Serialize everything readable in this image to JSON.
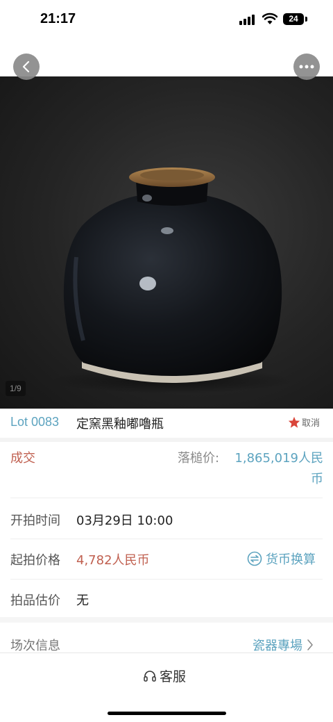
{
  "status_bar": {
    "time": "21:17",
    "battery": "24"
  },
  "header": {
    "back_icon": "chevron-left-icon",
    "more_icon": "more-horizontal-icon"
  },
  "photo": {
    "counter": "1/9"
  },
  "lot": {
    "number": "Lot 0083",
    "title": "定窯黑釉嘟嚕瓶",
    "favorite_label": "取消",
    "favorite_icon": "star-icon",
    "favorite_color": "#d9453a"
  },
  "result": {
    "status": "成交",
    "hammer_label": "落槌价:",
    "hammer_value": "1,865,019人民币"
  },
  "details": {
    "start_time_label": "开拍时间",
    "start_time_value": "03月29日 10:00",
    "start_price_label": "起拍价格",
    "start_price_value": "4,782人民币",
    "currency_convert_label": "货币换算",
    "estimate_label": "拍品估价",
    "estimate_value": "无"
  },
  "session": {
    "label": "场次信息",
    "value": "瓷器專場"
  },
  "bottom": {
    "service_label": "客服",
    "service_icon": "headset-icon"
  },
  "colors": {
    "accent_blue": "#5ca3bf",
    "accent_red": "#c06050"
  }
}
